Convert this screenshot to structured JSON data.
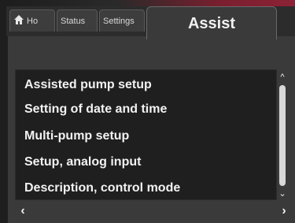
{
  "tabs": {
    "home": {
      "label": "Ho",
      "icon": "home-icon"
    },
    "status": {
      "label": "Status"
    },
    "settings": {
      "label": "Settings"
    },
    "active": {
      "label": "Assist"
    }
  },
  "menu": {
    "items": [
      {
        "label": "Assisted pump setup"
      },
      {
        "label": "Setting of date and time"
      },
      {
        "label": "Multi-pump setup"
      },
      {
        "label": "Setup, analog input"
      },
      {
        "label": "Description, control mode"
      }
    ]
  },
  "scrollbar": {
    "up_icon": "chevron-up-icon",
    "down_icon": "chevron-down-icon"
  },
  "navigation": {
    "back_icon": "chevron-left-icon",
    "forward_icon": "chevron-right-icon"
  },
  "colors": {
    "background": "#3a3a3a",
    "list_background": "#1f1f1f",
    "text": "#f2f2f2",
    "accent_bezel": "#8c2236"
  }
}
